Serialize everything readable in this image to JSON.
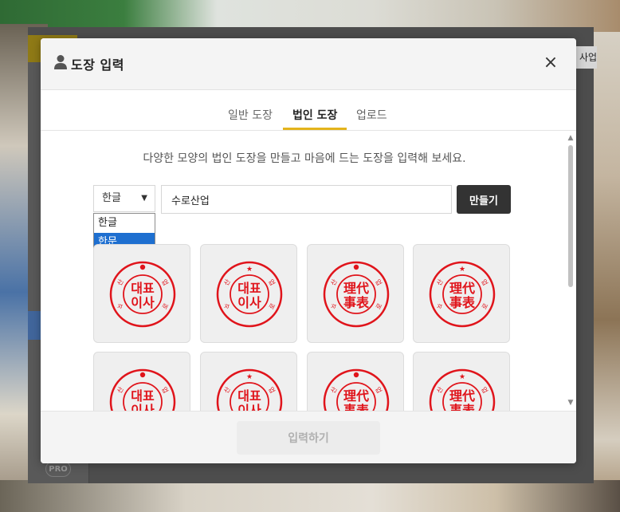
{
  "modal": {
    "title": "도장 입력",
    "close_symbol": "×",
    "description": "다양한 모양의 법인 도장을 만들고 마음에 드는 도장을 입력해 보세요.",
    "tabs": [
      {
        "label": "일반 도장",
        "active": false
      },
      {
        "label": "법인 도장",
        "active": true
      },
      {
        "label": "업로드",
        "active": false
      }
    ],
    "script_select": {
      "value": "한글",
      "options": [
        "한글",
        "한문"
      ],
      "highlighted_option": "한문"
    },
    "name_input": {
      "value": "수로산업"
    },
    "make_button_label": "만들기",
    "submit_button_label": "입력하기",
    "stamps": [
      {
        "top_mark": "dot",
        "center": [
          "대표",
          "이사"
        ],
        "ring_text": "수로산업"
      },
      {
        "top_mark": "star",
        "center": [
          "대표",
          "이사"
        ],
        "ring_text": "수로산업"
      },
      {
        "top_mark": "dot",
        "center": [
          "理代",
          "事表"
        ],
        "ring_text": "수로산업"
      },
      {
        "top_mark": "star",
        "center": [
          "理代",
          "事表"
        ],
        "ring_text": "수로산업"
      },
      {
        "top_mark": "dot",
        "center": [
          "대표",
          "이사"
        ],
        "ring_text": "수로산업"
      },
      {
        "top_mark": "star",
        "center": [
          "대표",
          "이사"
        ],
        "ring_text": "수로산업"
      },
      {
        "top_mark": "dot",
        "center": [
          "理代",
          "事表"
        ],
        "ring_text": "수로산업"
      },
      {
        "top_mark": "star",
        "center": [
          "理代",
          "事表"
        ],
        "ring_text": "수로산업"
      }
    ],
    "stamp_color": "#e0141b",
    "accent_color": "#e4b41c"
  },
  "background_app": {
    "badge": "PRO",
    "top_right_text": "사업"
  }
}
